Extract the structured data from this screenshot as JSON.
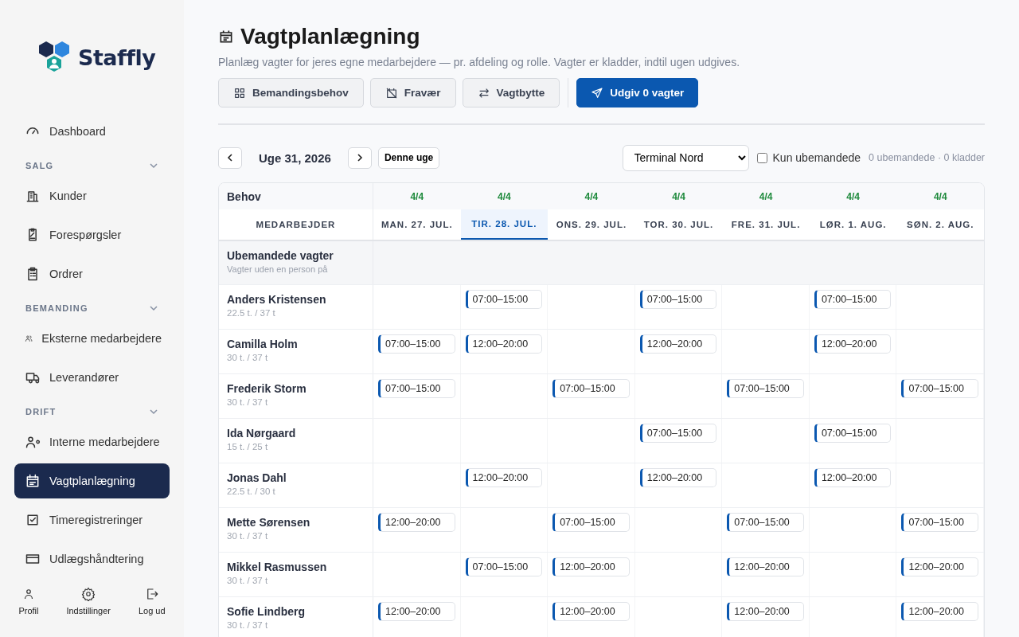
{
  "sidebar": {
    "logo": "Staffly",
    "sections": [
      {
        "items": [
          {
            "label": "Dashboard",
            "selected": false
          }
        ]
      },
      {
        "heading": "SALG",
        "expanded": true,
        "items": [
          {
            "label": "Kunder",
            "selected": false
          },
          {
            "label": "Forespørgsler",
            "selected": false
          },
          {
            "label": "Ordrer",
            "selected": false
          }
        ]
      },
      {
        "heading": "BEMANDING",
        "expanded": true,
        "items": [
          {
            "label": "Eksterne medarbejdere",
            "selected": false
          },
          {
            "label": "Leverandører",
            "selected": false
          }
        ]
      },
      {
        "heading": "DRIFT",
        "expanded": true,
        "items": [
          {
            "label": "Interne medarbejdere",
            "selected": false
          },
          {
            "label": "Vagtplanlægning",
            "selected": true
          },
          {
            "label": "Timeregistreringer",
            "selected": false
          },
          {
            "label": "Udlægshåndtering",
            "selected": false
          }
        ]
      }
    ],
    "footer": [
      "Profil",
      "Indstillinger",
      "Log ud"
    ]
  },
  "page": {
    "title": "Vagtplanlægning",
    "subtitle": "Planlæg vagter for jeres egne medarbejdere — pr. afdeling og rolle. Vagter er kladder, indtil ugen udgives.",
    "actions": [
      {
        "label": "Bemandingsbehov",
        "kind": "secondary"
      },
      {
        "label": "Fravær",
        "kind": "secondary"
      },
      {
        "label": "Vagtbytte",
        "kind": "secondary"
      },
      {
        "label": "Udgiv 0 vagter",
        "kind": "primary"
      }
    ]
  },
  "week": {
    "label": "Uge 31, 2026",
    "today_button": "Denne uge",
    "department": "Terminal Nord",
    "only_unstaffed": {
      "label": "Kun ubemandede",
      "checked": false
    },
    "summary": "0 ubemandede · 0 kladder"
  },
  "table": {
    "need_label": "Behov",
    "employee_header": "MEDARBEJDER",
    "days": [
      {
        "label": "MAN. 27. JUL.",
        "need": "4/4",
        "selected": false
      },
      {
        "label": "TIR. 28. JUL.",
        "need": "4/4",
        "selected": true
      },
      {
        "label": "ONS. 29. JUL.",
        "need": "4/4",
        "selected": false
      },
      {
        "label": "TOR. 30. JUL.",
        "need": "4/4",
        "selected": false
      },
      {
        "label": "FRE. 31. JUL.",
        "need": "4/4",
        "selected": false
      },
      {
        "label": "LØR. 1. AUG.",
        "need": "4/4",
        "selected": false
      },
      {
        "label": "SØN. 2. AUG.",
        "need": "4/4",
        "selected": false
      }
    ],
    "unstaffed": {
      "title": "Ubemandede vagter",
      "subtitle": "Vagter uden en person på"
    },
    "rows": [
      {
        "name": "Anders Kristensen",
        "hours": "22.5 t. / 37 t",
        "cells": [
          {
            "kind": "empty"
          },
          {
            "kind": "shift",
            "time": "07:00–15:00"
          },
          {
            "kind": "empty"
          },
          {
            "kind": "shift",
            "time": "07:00–15:00"
          },
          {
            "kind": "empty"
          },
          {
            "kind": "shift",
            "time": "07:00–15:00"
          },
          {
            "kind": "empty"
          }
        ]
      },
      {
        "name": "Camilla Holm",
        "hours": "30 t. / 37 t",
        "cells": [
          {
            "kind": "shift",
            "time": "07:00–15:00"
          },
          {
            "kind": "shift",
            "time": "12:00–20:00"
          },
          {
            "kind": "empty"
          },
          {
            "kind": "shift",
            "time": "12:00–20:00"
          },
          {
            "kind": "empty"
          },
          {
            "kind": "shift",
            "time": "12:00–20:00"
          },
          {
            "kind": "empty"
          }
        ]
      },
      {
        "name": "Frederik Storm",
        "hours": "30 t. / 37 t",
        "cells": [
          {
            "kind": "shift",
            "time": "07:00–15:00"
          },
          {
            "kind": "empty"
          },
          {
            "kind": "shift",
            "time": "07:00–15:00"
          },
          {
            "kind": "empty"
          },
          {
            "kind": "shift",
            "time": "07:00–15:00"
          },
          {
            "kind": "empty"
          },
          {
            "kind": "shift",
            "time": "07:00–15:00"
          }
        ]
      },
      {
        "name": "Ida Nørgaard",
        "hours": "15 t. / 25 t",
        "cells": [
          {
            "kind": "empty"
          },
          {
            "kind": "empty"
          },
          {
            "kind": "empty"
          },
          {
            "kind": "shift",
            "time": "07:00–15:00"
          },
          {
            "kind": "empty"
          },
          {
            "kind": "shift",
            "time": "07:00–15:00"
          },
          {
            "kind": "empty"
          }
        ]
      },
      {
        "name": "Jonas Dahl",
        "hours": "22.5 t. / 30 t",
        "cells": [
          {
            "kind": "empty"
          },
          {
            "kind": "shift",
            "time": "12:00–20:00"
          },
          {
            "kind": "empty"
          },
          {
            "kind": "shift",
            "time": "12:00–20:00"
          },
          {
            "kind": "empty"
          },
          {
            "kind": "shift",
            "time": "12:00–20:00"
          },
          {
            "kind": "empty"
          }
        ]
      },
      {
        "name": "Mette Sørensen",
        "hours": "30 t. / 37 t",
        "cells": [
          {
            "kind": "shift",
            "time": "12:00–20:00"
          },
          {
            "kind": "empty"
          },
          {
            "kind": "shift",
            "time": "07:00–15:00"
          },
          {
            "kind": "empty"
          },
          {
            "kind": "shift",
            "time": "07:00–15:00"
          },
          {
            "kind": "empty"
          },
          {
            "kind": "shift",
            "time": "07:00–15:00"
          }
        ]
      },
      {
        "name": "Mikkel Rasmussen",
        "hours": "30 t. / 37 t",
        "cells": [
          {
            "kind": "empty"
          },
          {
            "kind": "shift",
            "time": "07:00–15:00"
          },
          {
            "kind": "shift",
            "time": "12:00–20:00"
          },
          {
            "kind": "empty"
          },
          {
            "kind": "shift",
            "time": "12:00–20:00"
          },
          {
            "kind": "empty"
          },
          {
            "kind": "shift",
            "time": "12:00–20:00"
          }
        ]
      },
      {
        "name": "Sofie Lindberg",
        "hours": "30 t. / 37 t",
        "cells": [
          {
            "kind": "shift",
            "time": "12:00–20:00"
          },
          {
            "kind": "empty"
          },
          {
            "kind": "shift",
            "time": "12:00–20:00"
          },
          {
            "kind": "empty"
          },
          {
            "kind": "shift",
            "time": "12:00–20:00"
          },
          {
            "kind": "empty"
          },
          {
            "kind": "shift",
            "time": "12:00–20:00"
          }
        ]
      }
    ]
  }
}
